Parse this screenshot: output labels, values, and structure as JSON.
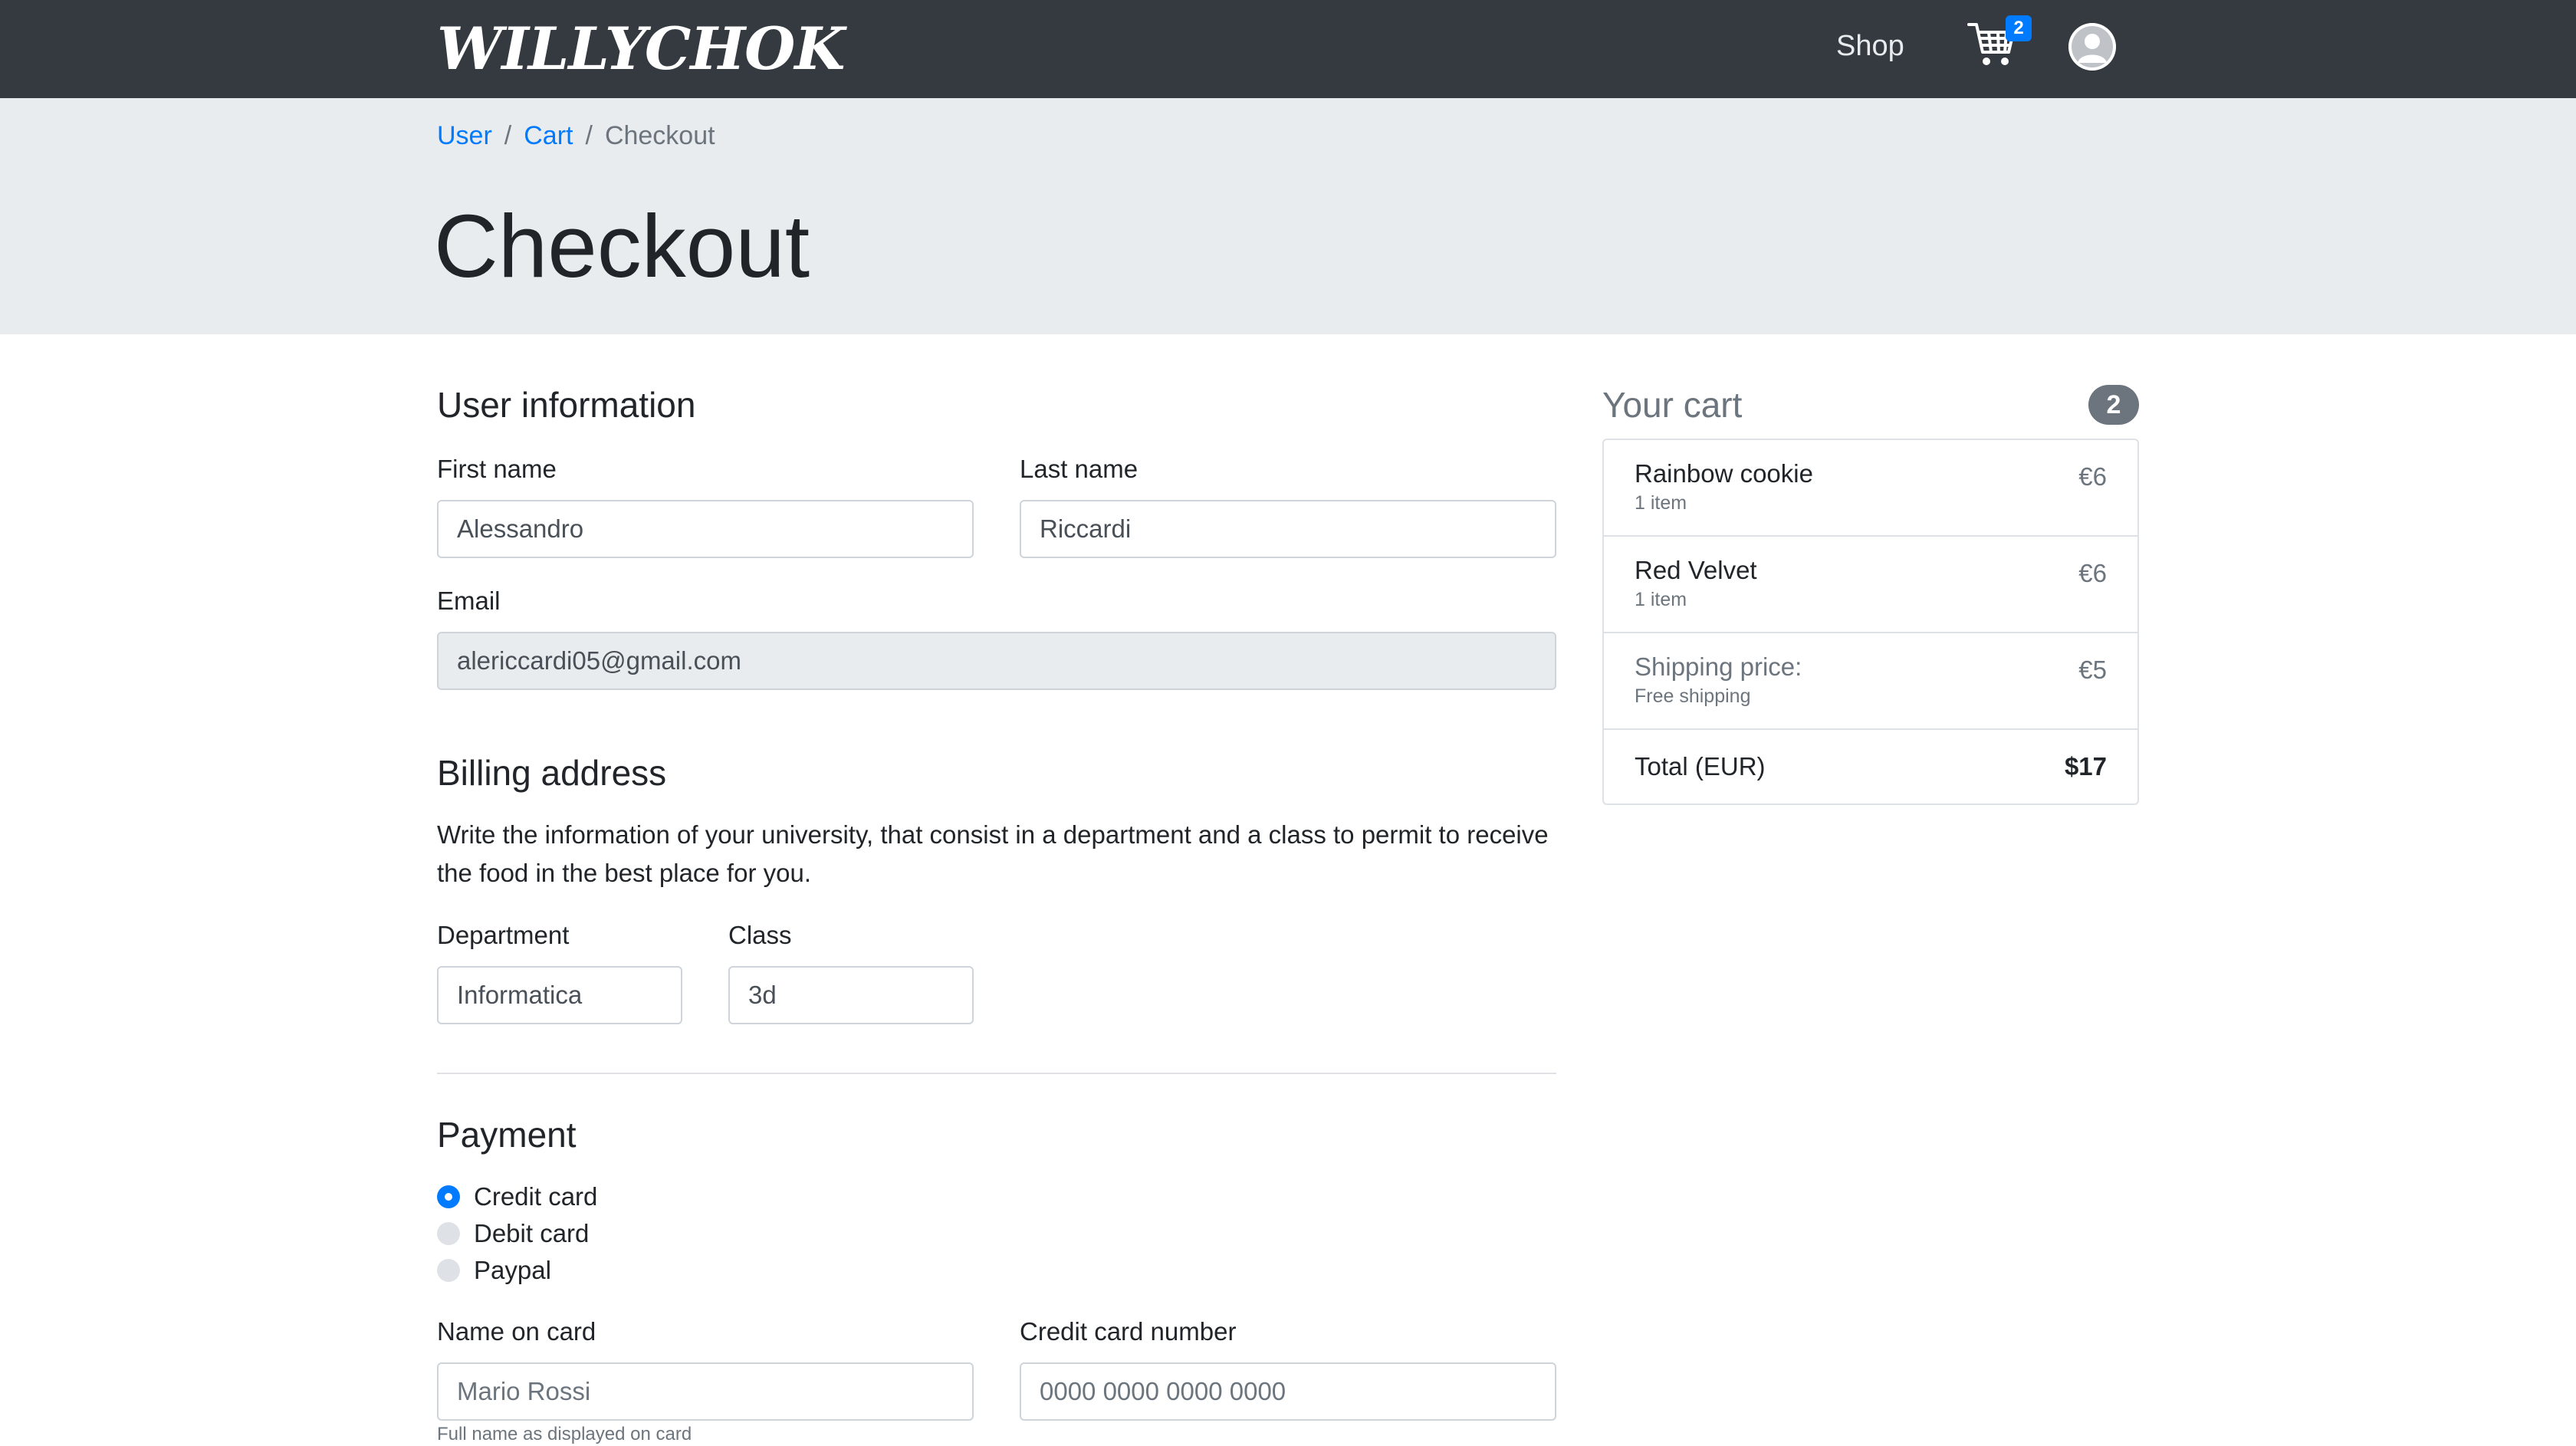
{
  "brand": "WILLYCHOK",
  "nav": {
    "shop_label": "Shop",
    "cart_count": "2"
  },
  "breadcrumb": {
    "items": [
      "User",
      "Cart",
      "Checkout"
    ]
  },
  "page_title": "Checkout",
  "user_info": {
    "title": "User information",
    "first_name_label": "First name",
    "first_name_value": "Alessandro",
    "last_name_label": "Last name",
    "last_name_value": "Riccardi",
    "email_label": "Email",
    "email_value": "alericcardi05@gmail.com"
  },
  "billing": {
    "title": "Billing address",
    "description": "Write the information of your university, that consist in a department and a class to permit to receive the food in the best place for you.",
    "department_label": "Department",
    "department_value": "Informatica",
    "class_label": "Class",
    "class_value": "3d"
  },
  "payment": {
    "title": "Payment",
    "methods": [
      "Credit card",
      "Debit card",
      "Paypal"
    ],
    "selected": "Credit card",
    "name_on_card_label": "Name on card",
    "name_on_card_placeholder": "Mario Rossi",
    "name_help": "Full name as displayed on card",
    "card_number_label": "Credit card number",
    "card_number_placeholder": "0000 0000 0000 0000"
  },
  "cart": {
    "title": "Your cart",
    "count": "2",
    "items": [
      {
        "name": "Rainbow cookie",
        "qty": "1 item",
        "price": "€6"
      },
      {
        "name": "Red Velvet",
        "qty": "1 item",
        "price": "€6"
      }
    ],
    "shipping": {
      "name": "Shipping price:",
      "sub": "Free shipping",
      "price": "€5"
    },
    "total_label": "Total (EUR)",
    "total_value": "$17"
  },
  "colors": {
    "navbar": "#343a40",
    "jumbotron": "#e9ecef",
    "accent": "#007bff",
    "muted": "#6c757d"
  },
  "icons": {
    "cart": "shopping-cart-icon",
    "avatar": "user-avatar-icon"
  }
}
